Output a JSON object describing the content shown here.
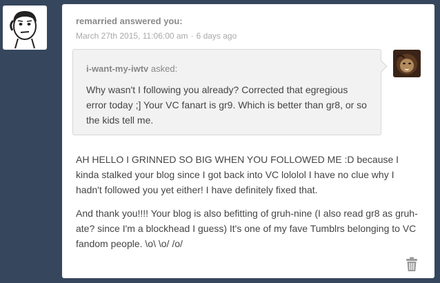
{
  "post": {
    "author": "remarried",
    "action": "answered you:",
    "date": "March 27th 2015, 11:06:00 am",
    "separator": "·",
    "relative_time": "6 days ago"
  },
  "question": {
    "asker": "i-want-my-iwtv",
    "asked_label": "asked:",
    "text": "Why wasn't I following you already? Corrected that egregious error today ;] Your VC fanart is gr9. Which is better than gr8, or so the kids tell me."
  },
  "answer": {
    "paragraphs": [
      "AH HELLO I GRINNED SO BIG WHEN YOU FOLLOWED ME :D because I kinda stalked your blog since I got back into VC lololol I have no clue why I hadn't followed you yet either!  I have definitely fixed that.",
      "And thank you!!!! Your blog is also befitting of gruh-nine (I also read gr8 as gruh-ate? since I'm a blockhead I guess) It's one of my fave Tumblrs belonging to VC fandom people. \\o\\ \\o/ /o/"
    ]
  },
  "icons": {
    "author_avatar": "face-avatar",
    "asker_avatar": "lion-avatar",
    "delete": "trash-icon"
  },
  "colors": {
    "background": "#36465d",
    "card": "#ffffff",
    "question_bg": "#f2f2f2",
    "meta_text": "#a8a8a8"
  }
}
